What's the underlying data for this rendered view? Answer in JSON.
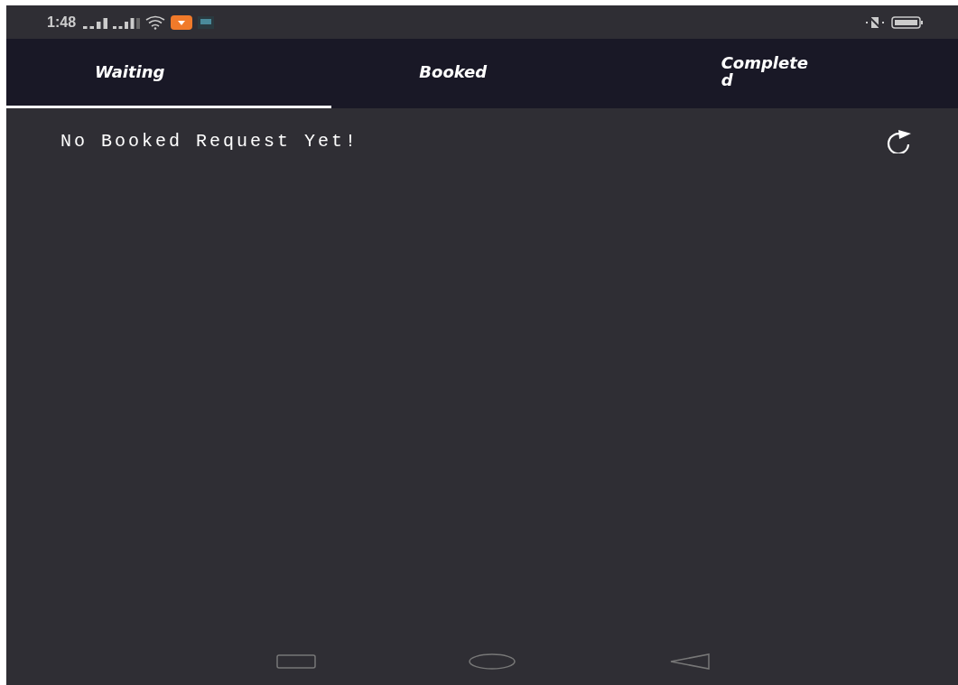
{
  "status_bar": {
    "time": "1:48"
  },
  "tabs": [
    {
      "label": "Waiting",
      "selected": true
    },
    {
      "label": "Booked",
      "selected": false
    },
    {
      "label": "Complete\nd",
      "selected": false
    }
  ],
  "message": "No Booked Request Yet!"
}
